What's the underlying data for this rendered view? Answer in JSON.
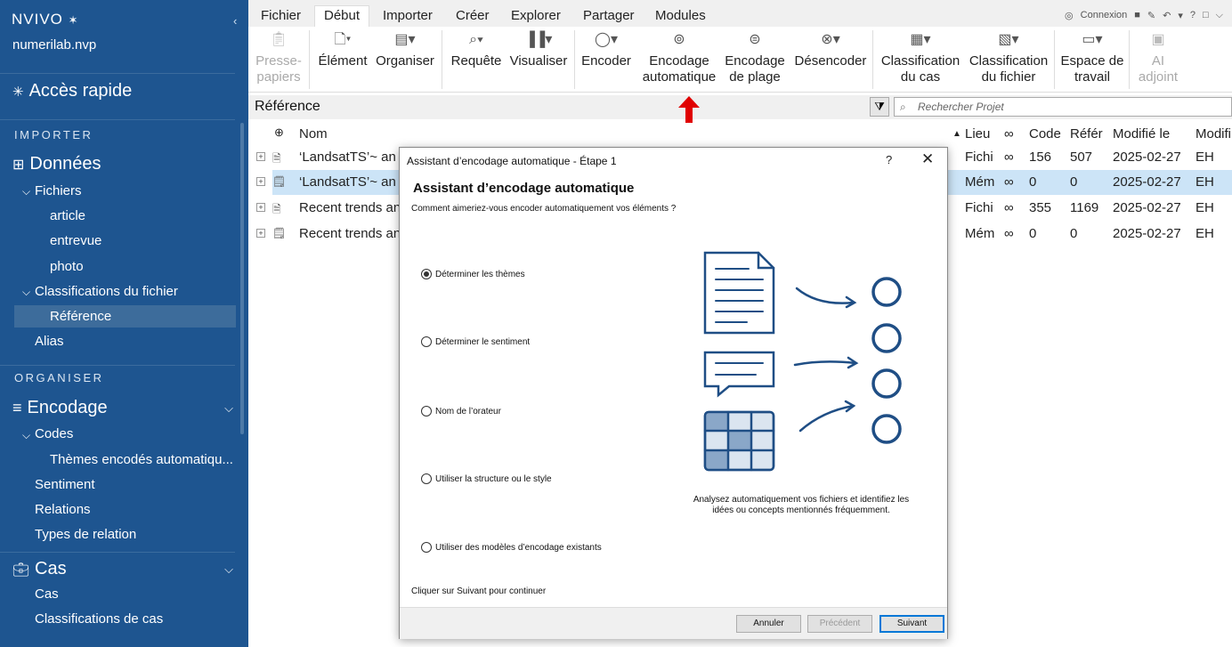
{
  "app": {
    "logo": "NVIVO",
    "logo_mark": "✶",
    "project": "numerilab.nvp",
    "collapse_glyph": "‹"
  },
  "sidebar": {
    "quick_access": "Accès rapide",
    "section_import": "IMPORTER",
    "data_group": "Données",
    "files": "Fichiers",
    "file_items": [
      "article",
      "entrevue",
      "photo"
    ],
    "file_classifications": "Classifications du fichier",
    "reference": "Référence",
    "aliases": "Alias",
    "section_organise": "ORGANISER",
    "coding_group": "Encodage",
    "codes": "Codes",
    "auto_themes": "Thèmes encodés automatiqu...",
    "sentiment": "Sentiment",
    "relations": "Relations",
    "relation_types": "Types de relation",
    "cases_group": "Cas",
    "cases": "Cas",
    "case_classifications": "Classifications de cas"
  },
  "tabs": [
    "Fichier",
    "Début",
    "Importer",
    "Créer",
    "Explorer",
    "Partager",
    "Modules"
  ],
  "active_tab": "Début",
  "account": {
    "label": "Connexion"
  },
  "ribbon": {
    "paste": [
      "Presse-",
      "papiers"
    ],
    "item": [
      "Élément"
    ],
    "organise": [
      "Organiser"
    ],
    "query": [
      "Requête"
    ],
    "visualise": [
      "Visualiser"
    ],
    "code": [
      "Encoder"
    ],
    "autocode": [
      "Encodage",
      "automatique"
    ],
    "range_code": [
      "Encodage",
      "de plage"
    ],
    "uncode": [
      "Désencoder"
    ],
    "case_class": [
      "Classification",
      "du cas"
    ],
    "file_class": [
      "Classification",
      "du fichier"
    ],
    "workspace": [
      "Espace de",
      "travail"
    ],
    "ai": [
      "AI",
      "adjoint"
    ]
  },
  "list": {
    "title": "Référence",
    "search_placeholder": "Rechercher Projet",
    "headers": {
      "name": "Nom",
      "location": "Lieu",
      "code": "Code",
      "refs": "Référ",
      "modified": "Modifié le",
      "modified_by": "Modifi"
    },
    "rows": [
      {
        "name": "‘LandsatTS’~ an l",
        "location": "Fichi",
        "code": "156",
        "refs": "507",
        "modified": "2025-02-27",
        "by": "EH"
      },
      {
        "name": "‘LandsatTS’~ an l",
        "location": "Mém",
        "code": "0",
        "refs": "0",
        "modified": "2025-02-27",
        "by": "EH"
      },
      {
        "name": "Recent trends and",
        "location": "Fichi",
        "code": "355",
        "refs": "1169",
        "modified": "2025-02-27",
        "by": "EH"
      },
      {
        "name": "Recent trends and",
        "location": "Mém",
        "code": "0",
        "refs": "0",
        "modified": "2025-02-27",
        "by": "EH"
      }
    ]
  },
  "dialog": {
    "title": "Assistant d’encodage automatique - Étape 1",
    "help": "?",
    "close": "✕",
    "heading": "Assistant d’encodage automatique",
    "question": "Comment aimeriez-vous encoder automatiquement vos éléments ?",
    "options": [
      "Déterminer les thèmes",
      "Déterminer le sentiment",
      "Nom de l’orateur",
      "Utiliser la structure ou le style",
      "Utiliser des modèles d’encodage existants"
    ],
    "selected_option": 0,
    "caption": "Analysez automatiquement vos fichiers et identifiez les idées ou concepts mentionnés fréquemment.",
    "hint": "Cliquer sur Suivant pour continuer",
    "buttons": {
      "cancel": "Annuler",
      "prev": "Précédent",
      "next": "Suivant"
    }
  },
  "colors": {
    "sidebar": "#1e5590",
    "accent": "#1f4e85",
    "selected_row": "#cce4f7",
    "annotation_arrow": "#e00000"
  }
}
